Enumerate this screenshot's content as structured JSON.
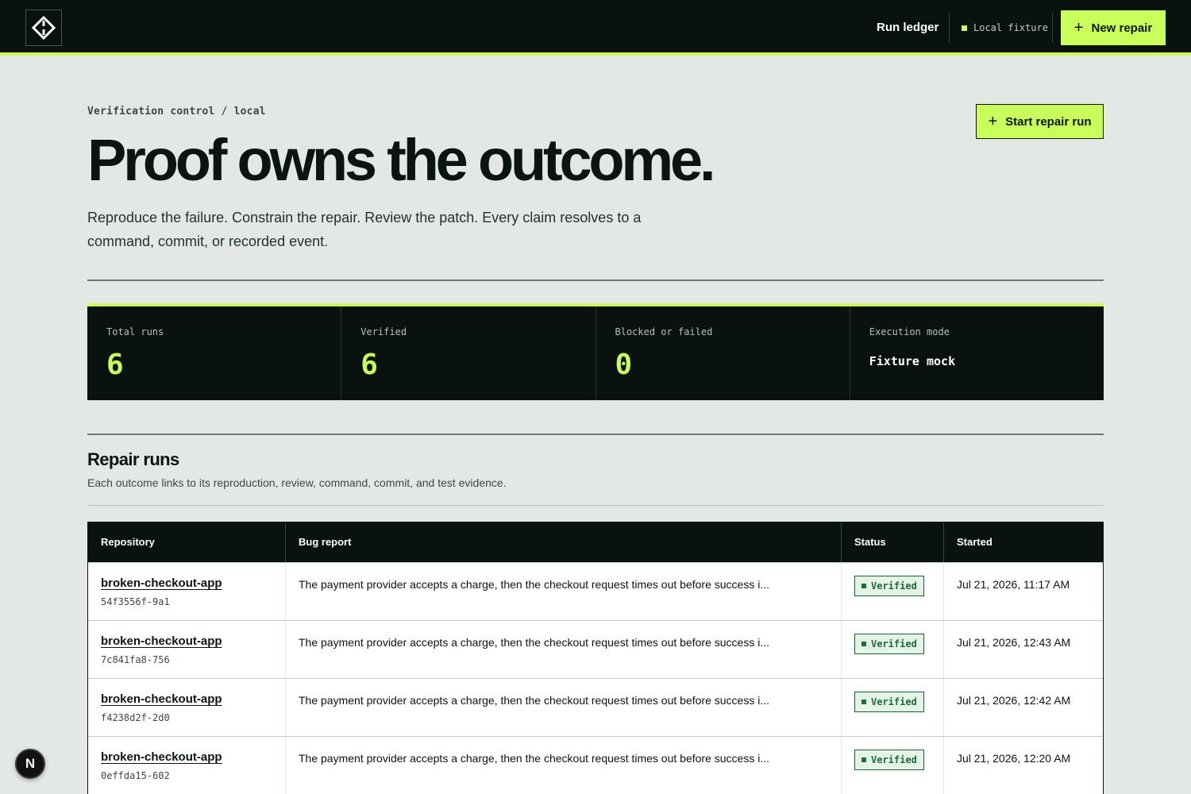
{
  "header": {
    "nav_link": "Run ledger",
    "mode_badge": "Local fixture",
    "new_repair_label": "New repair"
  },
  "hero": {
    "breadcrumb": "Verification control / local",
    "start_button_label": "Start repair run",
    "headline": "Proof owns the outcome.",
    "lede": "Reproduce the failure. Constrain the repair. Review the patch. Every claim resolves to a command, commit, or recorded event."
  },
  "stats": [
    {
      "label": "Total runs",
      "value": "6"
    },
    {
      "label": "Verified",
      "value": "6"
    },
    {
      "label": "Blocked or failed",
      "value": "0"
    },
    {
      "label": "Execution mode",
      "value": "Fixture mock"
    }
  ],
  "runs_section": {
    "title": "Repair runs",
    "subtitle": "Each outcome links to its reproduction, review, command, commit, and test evidence.",
    "columns": [
      "Repository",
      "Bug report",
      "Status",
      "Started"
    ],
    "rows": [
      {
        "repo": "broken-checkout-app",
        "id": "54f3556f-9a1",
        "bug": "The payment provider accepts a charge, then the checkout request times out before success i...",
        "status": "Verified",
        "started": "Jul 21, 2026, 11:17 AM"
      },
      {
        "repo": "broken-checkout-app",
        "id": "7c841fa8-756",
        "bug": "The payment provider accepts a charge, then the checkout request times out before success i...",
        "status": "Verified",
        "started": "Jul 21, 2026, 12:43 AM"
      },
      {
        "repo": "broken-checkout-app",
        "id": "f4238d2f-2d0",
        "bug": "The payment provider accepts a charge, then the checkout request times out before success i...",
        "status": "Verified",
        "started": "Jul 21, 2026, 12:42 AM"
      },
      {
        "repo": "broken-checkout-app",
        "id": "0effda15-602",
        "bug": "The payment provider accepts a charge, then the checkout request times out before success i...",
        "status": "Verified",
        "started": "Jul 21, 2026, 12:20 AM"
      }
    ]
  },
  "dev_indicator": "N",
  "colors": {
    "accent": "#c8ff5a",
    "dark": "#0a1210",
    "verified": "#1c6a3e"
  }
}
